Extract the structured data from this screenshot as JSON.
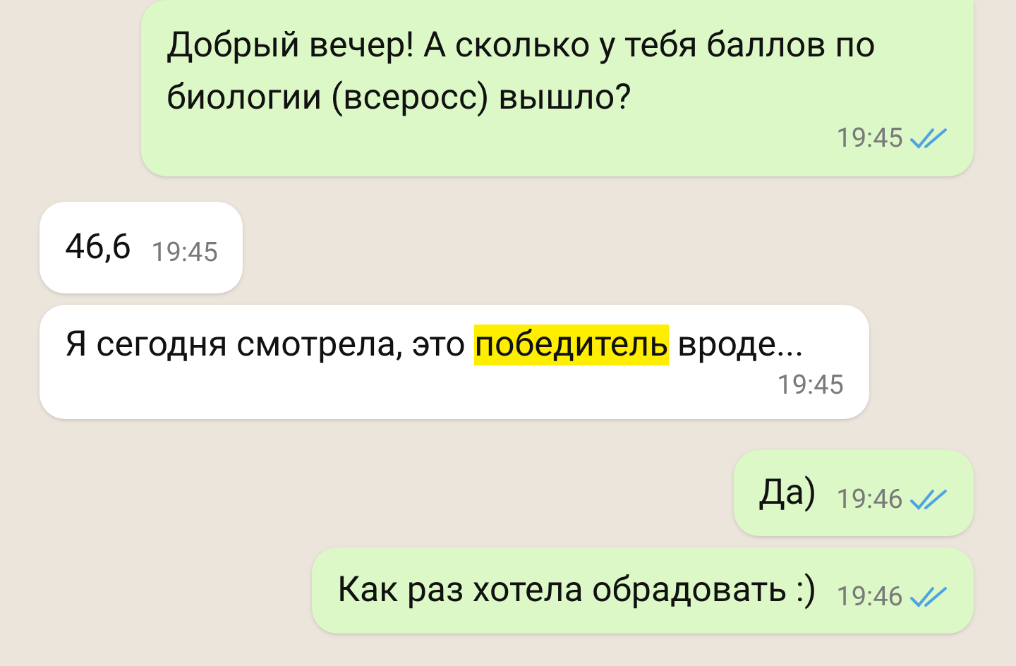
{
  "messages": [
    {
      "kind": "outgoing",
      "parts": [
        {
          "text": "Добрый вечер! А сколько у тебя баллов по биологии (всеросс) вышло?",
          "highlighted": false
        }
      ],
      "time": "19:45",
      "read": true
    },
    {
      "kind": "incoming",
      "parts": [
        {
          "text": "46,6",
          "highlighted": false
        }
      ],
      "time": "19:45"
    },
    {
      "kind": "incoming",
      "parts": [
        {
          "text": "Я сегодня смотрела, это ",
          "highlighted": false
        },
        {
          "text": "победитель",
          "highlighted": true
        },
        {
          "text": " вроде...",
          "highlighted": false
        }
      ],
      "time": "19:45"
    },
    {
      "kind": "outgoing",
      "parts": [
        {
          "text": "Да)",
          "highlighted": false
        }
      ],
      "time": "19:46",
      "read": true
    },
    {
      "kind": "outgoing",
      "parts": [
        {
          "text": "Как раз хотела обрадовать :)",
          "highlighted": false
        }
      ],
      "time": "19:46",
      "read": true
    }
  ]
}
